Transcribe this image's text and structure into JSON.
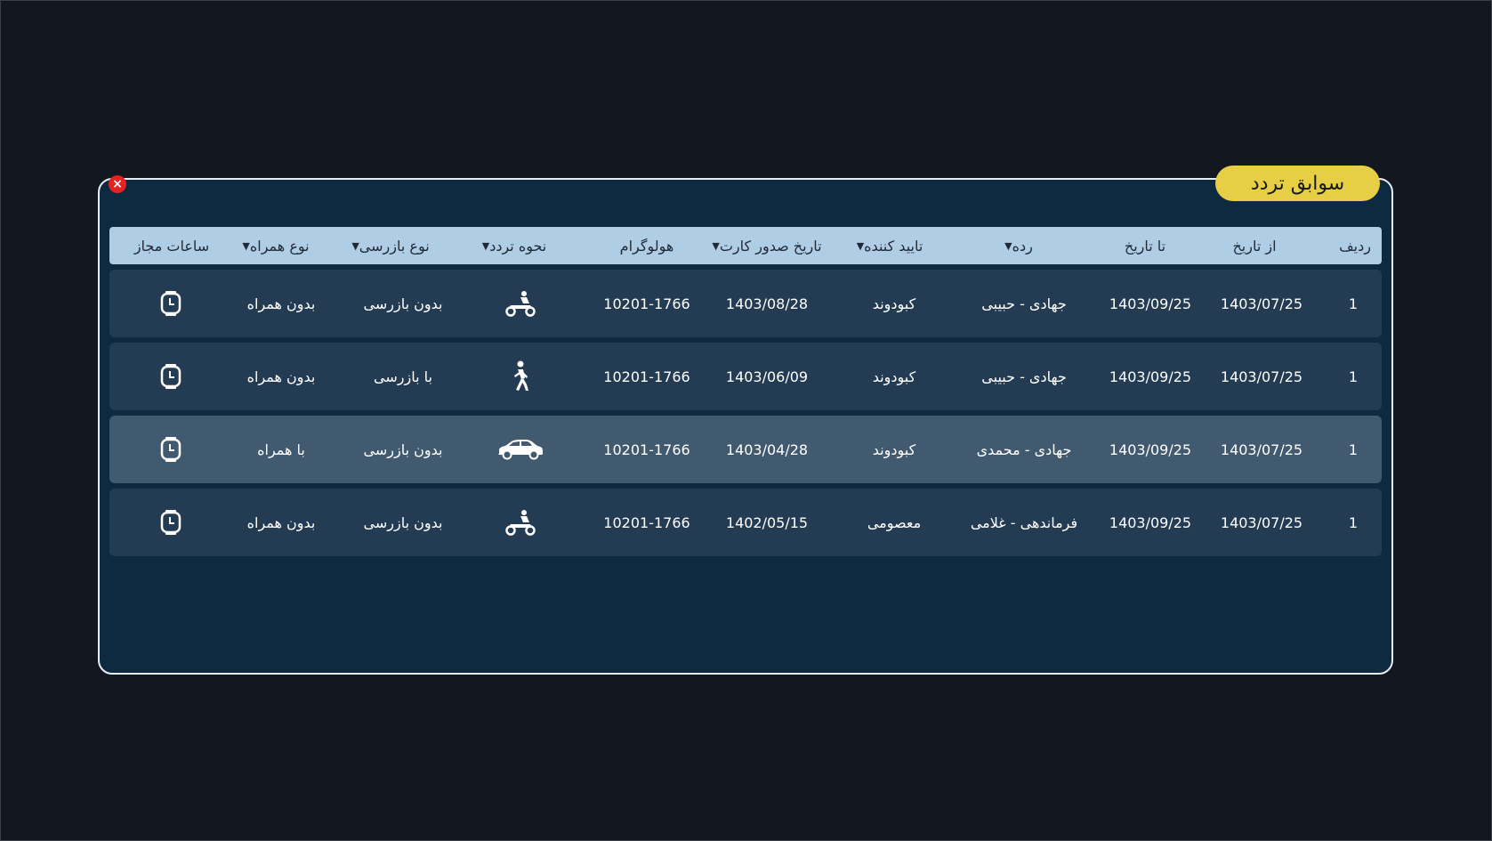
{
  "dialog": {
    "title": "سوابق تردد",
    "close_label": "×"
  },
  "columns": {
    "radif": "ردیف",
    "az_tarikh": "از تاریخ",
    "ta_tarikh": "تا تاریخ",
    "rade": "رده",
    "tayid": "تایید کننده",
    "tarikh_sodoor": "تاریخ صدور کارت",
    "hologram": "هولوگرام",
    "nahve": "نحوه تردد",
    "noe_bazresi": "نوع بازرسی",
    "noe_hamrah": "نوع همراه",
    "saat": "ساعات مجاز",
    "filter_glyph": "▼"
  },
  "rows": [
    {
      "radif": "1",
      "az_tarikh": "1403/07/25",
      "ta_tarikh": "1403/09/25",
      "rade": "جهادی - حبیبی",
      "tayid": "کبودوند",
      "tarikh_sodoor": "1403/08/28",
      "hologram": "10201-1766",
      "nahve_icon": "motorcycle-icon",
      "noe_bazresi": "بدون بازرسی",
      "noe_hamrah": "بدون همراه",
      "saat_icon": "watch-icon"
    },
    {
      "radif": "1",
      "az_tarikh": "1403/07/25",
      "ta_tarikh": "1403/09/25",
      "rade": "جهادی - حبیبی",
      "tayid": "کبودوند",
      "tarikh_sodoor": "1403/06/09",
      "hologram": "10201-1766",
      "nahve_icon": "pedestrian-icon",
      "noe_bazresi": "با بازرسی",
      "noe_hamrah": "بدون همراه",
      "saat_icon": "watch-icon"
    },
    {
      "radif": "1",
      "az_tarikh": "1403/07/25",
      "ta_tarikh": "1403/09/25",
      "rade": "جهادی - محمدی",
      "tayid": "کبودوند",
      "tarikh_sodoor": "1403/04/28",
      "hologram": "10201-1766",
      "nahve_icon": "car-icon",
      "noe_bazresi": "بدون بازرسی",
      "noe_hamrah": "با همراه",
      "saat_icon": "watch-icon"
    },
    {
      "radif": "1",
      "az_tarikh": "1403/07/25",
      "ta_tarikh": "1403/09/25",
      "rade": "فرماندهی - غلامی",
      "tayid": "معصومی",
      "tarikh_sodoor": "1402/05/15",
      "hologram": "10201-1766",
      "nahve_icon": "motorcycle-icon",
      "noe_bazresi": "بدون بازرسی",
      "noe_hamrah": "بدون همراه",
      "saat_icon": "watch-icon"
    }
  ],
  "colors": {
    "background": "#131720",
    "panel": "#0d2a40",
    "header": "#b0cde6",
    "row": "#243c53",
    "row_highlight": "#425a6f",
    "title_pill": "#e7cf45",
    "close": "#e52222"
  }
}
